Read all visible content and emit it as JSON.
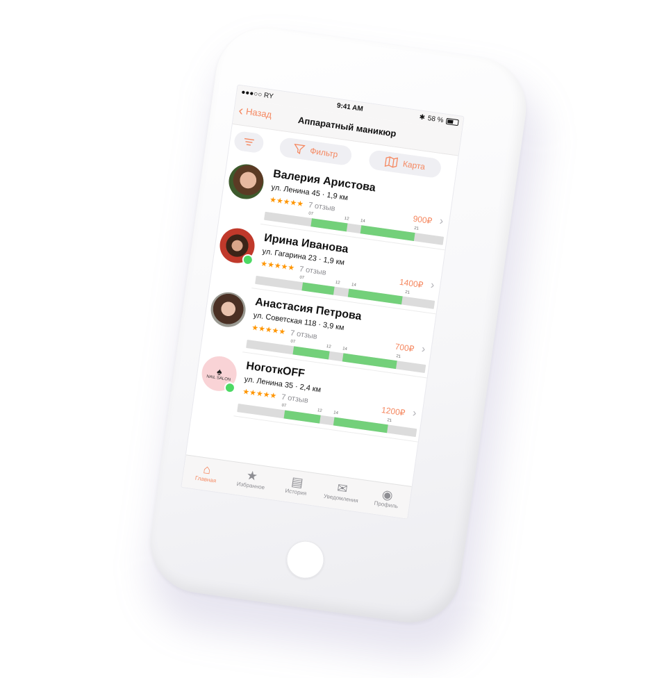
{
  "status": {
    "carrier": "●●●○○ RY",
    "time": "9:41 AM",
    "battery": "58 %"
  },
  "nav": {
    "back_label": "Назад",
    "title": "Аппаратный маникюр"
  },
  "toolbar": {
    "filter_label": "Фильтр",
    "map_label": "Карта"
  },
  "masters": [
    {
      "name": "Валерия Аристова",
      "address": "ул. Ленина 45 · 1,9 км",
      "rating_stars": "★★★★★",
      "reviews": "7 отзыв",
      "price": "900₽",
      "online": false,
      "ticks": [
        "07",
        "12",
        "14",
        "21"
      ]
    },
    {
      "name": "Ирина Иванова",
      "address": "ул. Гагарина 23 · 1,9 км",
      "rating_stars": "★★★★★",
      "reviews": "7 отзыв",
      "price": "1400₽",
      "online": true,
      "ticks": [
        "07",
        "12",
        "14",
        "21"
      ]
    },
    {
      "name": "Анастасия Петрова",
      "address": "ул. Советская 118 · 3,9 км",
      "rating_stars": "★★★★★",
      "reviews": "7 отзыв",
      "price": "700₽",
      "online": false,
      "ticks": [
        "07",
        "12",
        "14",
        "21"
      ]
    },
    {
      "name": "НоготкOFF",
      "address": "ул. Ленина 35 · 2,4 км",
      "rating_stars": "★★★★★",
      "reviews": "7 отзыв",
      "price": "1200₽",
      "online": true,
      "logo_text": "NAIL SALON",
      "ticks": [
        "07",
        "12",
        "14",
        "21"
      ]
    }
  ],
  "tabs": [
    {
      "label": "Главная",
      "icon": "home-icon",
      "active": true
    },
    {
      "label": "Избранное",
      "icon": "star-icon",
      "active": false
    },
    {
      "label": "История",
      "icon": "archive-icon",
      "active": false
    },
    {
      "label": "Уведомления",
      "icon": "mail-icon",
      "active": false
    },
    {
      "label": "Профиль",
      "icon": "profile-icon",
      "active": false
    }
  ],
  "colors": {
    "accent": "#f5875f",
    "available": "#73d07a",
    "busy": "#dcdcdc",
    "star": "#ff9500",
    "online": "#4cd964"
  }
}
